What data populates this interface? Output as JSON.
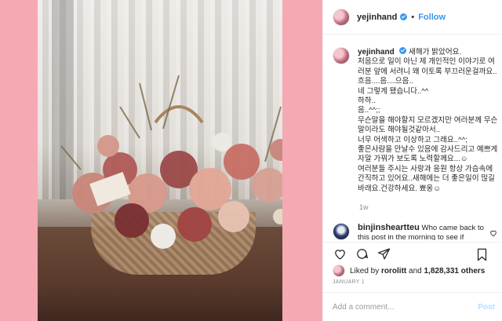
{
  "post": {
    "username": "yejinhand",
    "follow_label": "Follow",
    "dot": "•",
    "caption_lines": [
      "새해가 밝았어요.",
      "처음으로 일이 아닌 제 개인적인 이야기로 여러분 앞에 서려니 왜 이토록 부끄러운걸까요..",
      "흐음....음....으음..",
      "네 그렇게 됐습니다..^^",
      "하하..",
      "음..^^;;",
      "무슨말을 해야할지 모르겠지만 여러분께 무슨 말이라도 해야될것같아서..",
      "너무 어색하고 이상하고 그래요..^^;",
      "좋은사람을 만날수 있음에 감사드리고 예쁘게 자알 가꿔가 보도록 노력할께요...☺",
      "여러분들 주시는 사랑과 응원 항상 가슴속에 간직하고 있어요..새해에는 더 좋은일이 많길 바래요.건강하세요. 뾰옹☺"
    ],
    "caption_time": "1w",
    "comment": {
      "username": "binjinsheartteu",
      "text": "Who came back to this post in the morning to see if"
    },
    "likes": {
      "prefix": "Liked by",
      "liker": "rorolitt",
      "conj": "and",
      "count": "1,828,331 others"
    },
    "date": "JANUARY 1",
    "add_comment_placeholder": "Add a comment...",
    "post_label": "Post"
  },
  "icons": {
    "verified": "verified-badge-icon",
    "like": "heart-icon",
    "comment": "comment-icon",
    "share": "share-icon",
    "save": "bookmark-icon"
  },
  "colors": {
    "background": "#f4a9b3",
    "accent": "#3897f0",
    "post_disabled": "#b3dbff"
  }
}
